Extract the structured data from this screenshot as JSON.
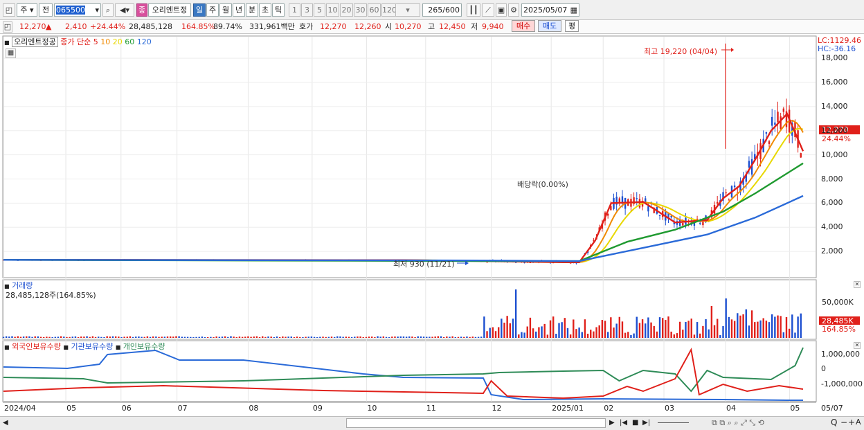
{
  "toolbar": {
    "period_toggle": "주",
    "prev_label": "전",
    "stock_code": "065500",
    "stock_badge": "종",
    "stock_name": "오리엔트정",
    "interval_buttons": [
      "일",
      "주",
      "월",
      "년",
      "분",
      "초",
      "틱"
    ],
    "minute_buttons": [
      "1",
      "3",
      "5",
      "10",
      "20",
      "30",
      "60",
      "120"
    ],
    "count_value": "265",
    "count_max": "/600",
    "date_value": "2025/05/07"
  },
  "quote": {
    "price": "12,270",
    "change": "2,410",
    "change_pct": "+24.44%",
    "volume": "28,485,128",
    "volume_ratio": "164.85%",
    "turnover_ratio": "89.74%",
    "amount": "331,961백만",
    "ask_label": "호가",
    "ask": "12,270",
    "bid": "12,260",
    "open_label": "시",
    "open": "10,270",
    "high_label": "고",
    "high": "12,450",
    "low_label": "저",
    "low": "9,940",
    "buy_label": "매수",
    "sell_label": "매도",
    "avg_label": "평"
  },
  "price_panel": {
    "title": "오리엔트정공",
    "legend_prefix": "종가 단순",
    "ma_labels": [
      "5",
      "10",
      "20",
      "60",
      "120"
    ],
    "ma_colors": [
      "#e0201a",
      "#f08a00",
      "#e8d800",
      "#1f9a30",
      "#2a6ad8"
    ],
    "lc": "LC:1129.46",
    "hc": "HC:-36.16",
    "high_annotation": "최고 19,220 (04/04)",
    "low_annotation": "최저 930 (11/21)",
    "dividend_annotation": "배당락(0.00%)",
    "current_price_tag": "12,270",
    "current_pct_tag": "24.44%",
    "y_ticks": [
      "18,000",
      "16,000",
      "14,000",
      "12,000",
      "10,000",
      "8,000",
      "6,000",
      "4,000",
      "2,000"
    ]
  },
  "volume_panel": {
    "title": "거래량",
    "value_text": "28,485,128주(164.85%)",
    "y_tick": "50,000K",
    "current_tag": "28,485K",
    "current_pct": "164.85%"
  },
  "holdings_panel": {
    "series_labels": [
      "외국인보유수량",
      "기관보유수량",
      "개인보유수량"
    ],
    "series_colors": [
      "#e0201a",
      "#2a6ad8",
      "#2e8b57"
    ],
    "y_ticks": [
      "1,000,000",
      "0",
      "-1,000,000"
    ]
  },
  "x_axis": {
    "labels": [
      "2024/04",
      "05",
      "06",
      "07",
      "08",
      "09",
      "10",
      "11",
      "12",
      "2025/01",
      "02",
      "03",
      "04",
      "05",
      "05/07"
    ]
  },
  "chart_data": {
    "type": "candlestick",
    "title": "오리엔트정공",
    "ylim": [
      0,
      19500
    ],
    "moving_averages": [
      {
        "name": "5",
        "x": [
          0,
          0.5,
          0.6,
          0.7,
          0.72,
          0.74,
          0.76,
          0.8,
          0.84,
          0.88,
          0.9,
          0.92,
          0.94,
          0.96,
          0.98,
          1.0
        ],
        "values": [
          1300,
          1280,
          1200,
          1100,
          1100,
          2900,
          6000,
          6100,
          4400,
          4600,
          6400,
          7400,
          9600,
          12000,
          13400,
          10300
        ]
      },
      {
        "name": "60",
        "x": [
          0,
          0.6,
          0.72,
          0.78,
          0.84,
          0.9,
          0.94,
          1.0
        ],
        "values": [
          1300,
          1200,
          1200,
          2800,
          3800,
          5300,
          6800,
          9300
        ]
      },
      {
        "name": "120",
        "x": [
          0,
          0.6,
          0.72,
          0.8,
          0.88,
          0.94,
          1.0
        ],
        "values": [
          1300,
          1250,
          1200,
          2300,
          3400,
          4800,
          6600
        ]
      }
    ],
    "current_price": 12270,
    "high": 19220,
    "low": 930
  }
}
